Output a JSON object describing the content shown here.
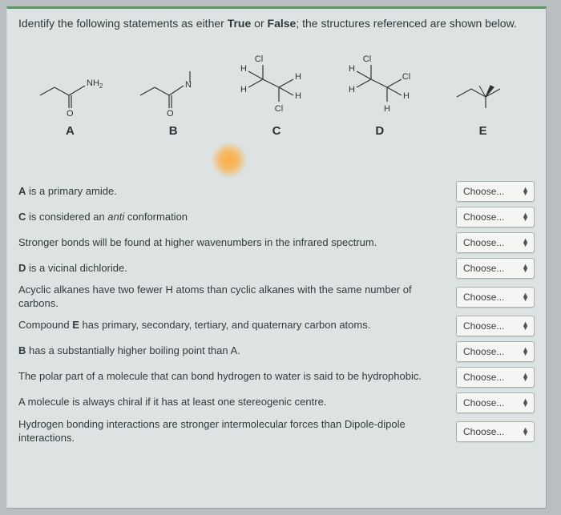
{
  "instruction": {
    "prefix": "Identify the following statements as either ",
    "true_word": "True",
    "mid": " or ",
    "false_word": "False",
    "suffix": "; the structures referenced are shown below."
  },
  "struct_labels": {
    "a": "A",
    "b": "B",
    "c": "C",
    "d": "D",
    "e": "E"
  },
  "atoms": {
    "nh2": "NH",
    "nh2_sub": "2",
    "o": "O",
    "n": "N",
    "cl": "Cl",
    "h": "H"
  },
  "dropdown_label": "Choose...",
  "questions": [
    {
      "html": "<b>A</b> is a primary amide."
    },
    {
      "html": "<b>C</b> is considered an <span class='ital'>anti</span> conformation"
    },
    {
      "html": "Stronger bonds will be found at higher wavenumbers in the infrared spectrum."
    },
    {
      "html": "<b>D</b> is a vicinal dichloride."
    },
    {
      "html": "Acyclic alkanes have two fewer H atoms than cyclic alkanes with the same number of carbons."
    },
    {
      "html": "Compound <b>E</b> has primary, secondary, tertiary, and quaternary carbon atoms."
    },
    {
      "html": "<b>B</b> has a substantially higher boiling point than A."
    },
    {
      "html": "The polar part of a molecule that can bond hydrogen to water is said to be hydrophobic."
    },
    {
      "html": "A molecule is always chiral if it has at least one stereogenic centre."
    },
    {
      "html": "Hydrogen bonding interactions are stronger intermolecular forces than Dipole-dipole interactions."
    }
  ]
}
